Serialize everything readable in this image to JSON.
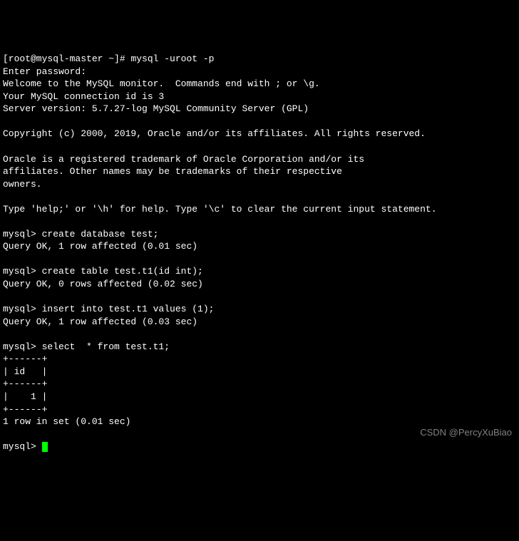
{
  "terminal": {
    "shell_prompt": "[root@mysql-master ~]# ",
    "shell_command": "mysql -uroot -p",
    "password_prompt": "Enter password:",
    "welcome_line": "Welcome to the MySQL monitor.  Commands end with ; or \\g.",
    "connection_line": "Your MySQL connection id is 3",
    "version_line": "Server version: 5.7.27-log MySQL Community Server (GPL)",
    "copyright_line": "Copyright (c) 2000, 2019, Oracle and/or its affiliates. All rights reserved.",
    "trademark_line1": "Oracle is a registered trademark of Oracle Corporation and/or its",
    "trademark_line2": "affiliates. Other names may be trademarks of their respective",
    "trademark_line3": "owners.",
    "help_line": "Type 'help;' or '\\h' for help. Type '\\c' to clear the current input statement.",
    "mysql_prompt": "mysql> ",
    "cmd1": "create database test;",
    "res1": "Query OK, 1 row affected (0.01 sec)",
    "cmd2": "create table test.t1(id int);",
    "res2": "Query OK, 0 rows affected (0.02 sec)",
    "cmd3": "insert into test.t1 values (1);",
    "res3": "Query OK, 1 row affected (0.03 sec)",
    "cmd4": "select  * from test.t1;",
    "table_border": "+------+",
    "table_header": "| id   |",
    "table_row1": "|    1 |",
    "result_summary": "1 row in set (0.01 sec)"
  },
  "watermark": "CSDN @PercyXuBiao"
}
